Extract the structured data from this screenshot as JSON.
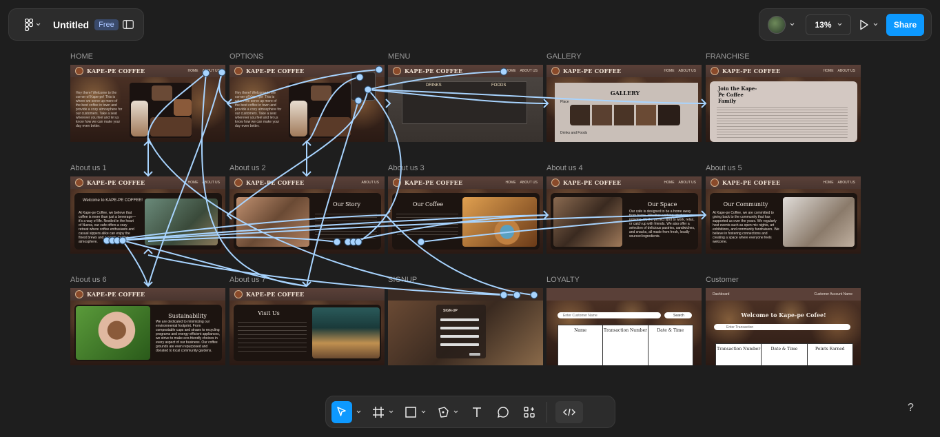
{
  "file": {
    "title": "Untitled",
    "plan_badge": "Free"
  },
  "header": {
    "zoom": "13%",
    "share_label": "Share"
  },
  "brand": "KAPE-PE COFFEE",
  "nav_links": {
    "home": "HOME",
    "about": "ABOUT US"
  },
  "frames": {
    "home": "HOME",
    "options": "OPTIONS",
    "menu": "MENU",
    "gallery": "GALLERY",
    "franchise": "FRANCHISE",
    "about1": "About us 1",
    "about2": "About us 2",
    "about3": "About us 3",
    "about4": "About us 4",
    "about5": "About us 5",
    "about6": "About us 6",
    "about7": "About us 7",
    "signup": "SIGNUP",
    "loyalty": "LOYALTY",
    "customer": "Customer"
  },
  "content": {
    "home_text": "Hey there! Welcome to the corner of Kape-pe! This is where we serve up more of the best coffee in town and provide a cozy atmosphere for our customers. Take a seat wherever you feel and let us know how we can make your day even better.",
    "menu_drinks": "DRINKS",
    "menu_foods": "FOODS",
    "gallery_title": "GALLERY",
    "gallery_place": "Place",
    "gallery_drinks": "Drinks and Foods",
    "franchise_title": "Join the Kape-Pe Coffee Family",
    "about1_title": "Welcome to KAPE-PE COFFEE!",
    "about1_text": "At Kape-pe Coffee, we believe that coffee is more than just a beverage—it's a way of life. Nestled in the heart of Nueva, our cafe offers a cozy retreat where coffee enthusiasts and casual sippers alike can enjoy the finest brews and a warm, inviting atmosphere.",
    "about2_title": "Our Story",
    "about3_title": "Our Coffee",
    "about4_title": "Our Space",
    "about4_text": "Our cafe is designed to be a home away from home. Whether working, studying or relaxing, it's the perfect spot to work, relax, or catch up with friends. We also offer a selection of delicious pastries, sandwiches, and snacks, all made from fresh, locally sourced ingredients.",
    "about5_title": "Our Community",
    "about5_text": "At Kape-pe Coffee, we are committed to giving back to the community that has supported us over the years. We regularly host events such as open mic nights, art exhibitions, and community fundraisers. We believe in fostering connections and creating a space where everyone feels welcome.",
    "about6_title": "Sustainability",
    "about6_text": "We are dedicated to minimizing our environmental footprint. From compostable cups and straws to recycling programs and energy-efficient appliances, we strive to make eco-friendly choices in every aspect of our business. Our coffee grounds are even repurposed and donated to local community gardens.",
    "about7_title": "Visit Us",
    "signup_title": "SIGN-UP",
    "loyalty_search_placeholder": "Enter Customer Name",
    "loyalty_search_button": "Search",
    "loyalty_cols": [
      "Name",
      "Transaction Number",
      "Date & Time"
    ],
    "customer_dashboard": "Dashboard",
    "customer_account": "Customer Account Name",
    "customer_welcome": "Welcome to Kape-pe Cofee!",
    "customer_search_placeholder": "Enter Transaction",
    "customer_cols": [
      "Transaction Number",
      "Date & Time",
      "Points Earned"
    ]
  },
  "colors": {
    "accent": "#0d99ff",
    "canvas": "#1e1e1e",
    "prototype_link": "#a8d4ff"
  }
}
